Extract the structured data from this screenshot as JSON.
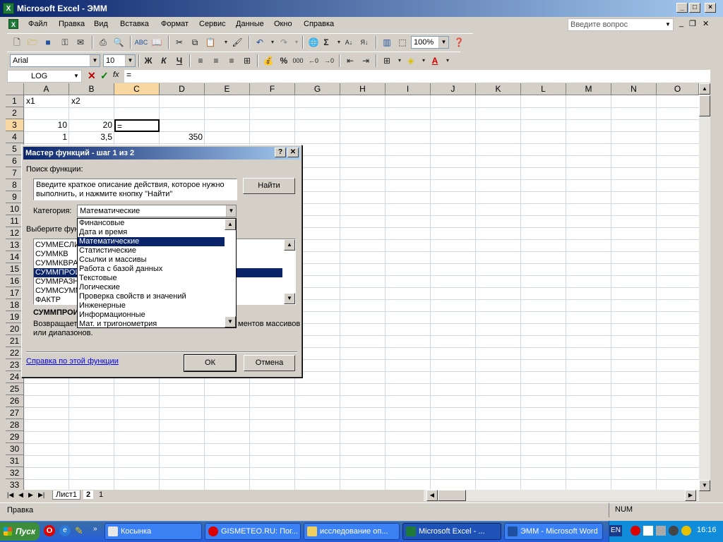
{
  "window": {
    "title": "Microsoft Excel - ЭММ",
    "icon": "excel-icon"
  },
  "menu": [
    "Файл",
    "Правка",
    "Вид",
    "Вставка",
    "Формат",
    "Сервис",
    "Данные",
    "Окно",
    "Справка"
  ],
  "ask_question": {
    "placeholder": "Введите вопрос"
  },
  "toolbar": {
    "zoom": "100%",
    "font": "Arial",
    "size": "10",
    "bold": "Ж",
    "italic": "К",
    "underline": "Ч",
    "percent": "%",
    "thousands": "000"
  },
  "formula_bar": {
    "namebox": "LOG",
    "fx": "fx",
    "content": "="
  },
  "columns": [
    "A",
    "B",
    "C",
    "D",
    "E",
    "F",
    "G",
    "H",
    "I",
    "J",
    "K",
    "L",
    "M",
    "N",
    "O"
  ],
  "rows": [
    "1",
    "2",
    "3",
    "4",
    "5",
    "6",
    "7",
    "8",
    "9",
    "10",
    "11",
    "12",
    "13",
    "14",
    "15",
    "16",
    "17",
    "18",
    "19",
    "20",
    "21",
    "22",
    "23",
    "24",
    "25",
    "26",
    "27",
    "28",
    "29",
    "30",
    "31",
    "32",
    "33"
  ],
  "cells": {
    "A1": "x1",
    "B1": "x2",
    "A3": "10",
    "B3": "20",
    "C3": "=",
    "A4": "1",
    "B4": "3,5",
    "D4": "350"
  },
  "sheet_tabs": [
    "Лист1",
    "2",
    "1"
  ],
  "status": {
    "left": "Правка",
    "num": "NUM"
  },
  "dialog": {
    "title": "Мастер функций - шаг 1 из 2",
    "search_label": "Поиск функции:",
    "search_text": "Введите краткое описание действия, которое нужно выполнить, и нажмите кнопку \"Найти\"",
    "find_button": "Найти",
    "category_label": "Категория:",
    "category_value": "Математические",
    "select_label": "Выберите функ",
    "functions": [
      "СУММЕСЛИ",
      "СУММКВ",
      "СУММКВРАЗ",
      "СУММПРОИЗВ",
      "СУММРАЗН",
      "СУММСУММ",
      "ФАКТР"
    ],
    "selected_function": "СУММПРОИ",
    "desc_title": "СУММПРОИ",
    "desc_left": "Возвращает",
    "desc_right": "ментов массивов",
    "desc_line2": "или диапазонов.",
    "help_link": "Справка по этой функции",
    "ok": "ОК",
    "cancel": "Отмена",
    "categories": [
      "Финансовые",
      "Дата и время",
      "Математические",
      "Статистические",
      "Ссылки и массивы",
      "Работа с базой данных",
      "Текстовые",
      "Логические",
      "Проверка свойств и значений",
      "Инженерные",
      "Информационные",
      "Мат. и тригонометрия"
    ]
  },
  "taskbar": {
    "start": "Пуск",
    "items": [
      "Косынка",
      "GISMETEO.RU: Пог...",
      "исследование оп...",
      "Microsoft Excel - ...",
      "ЭММ - Microsoft Word"
    ],
    "lang": "EN",
    "clock": "16:16"
  }
}
